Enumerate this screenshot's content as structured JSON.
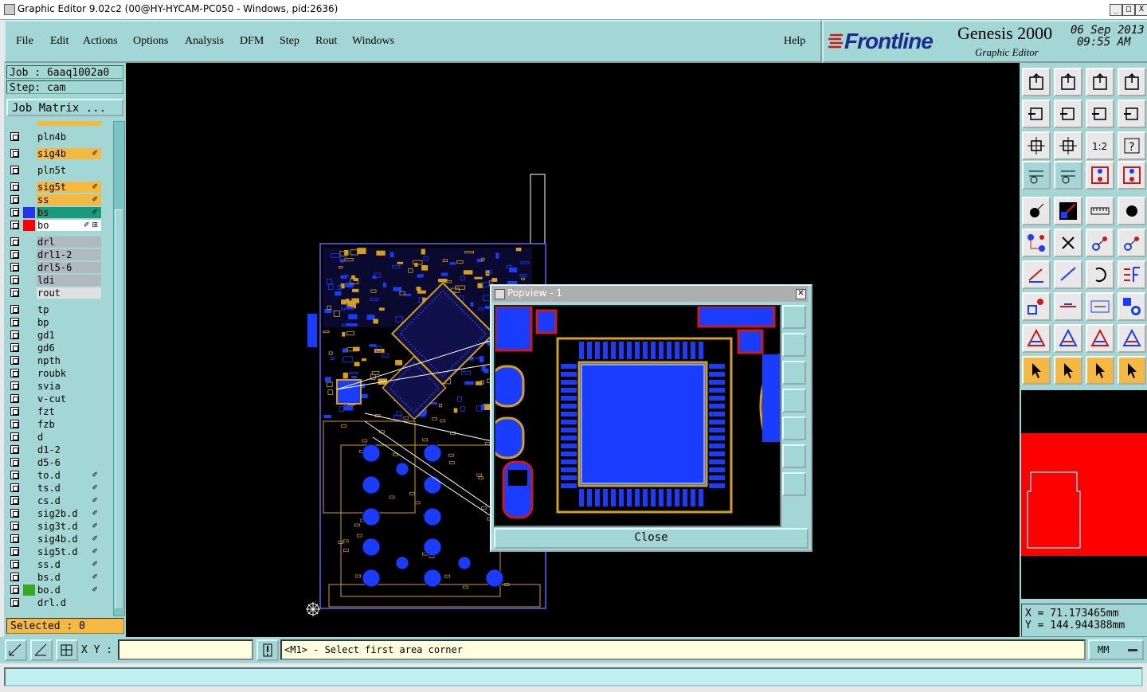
{
  "window": {
    "title": "Graphic Editor 9.02c2 (00@HY-HYCAM-PC050 - Windows, pid:2636)",
    "controls": [
      "_",
      "□",
      "X"
    ]
  },
  "menu": {
    "items": [
      "File",
      "Edit",
      "Actions",
      "Options",
      "Analysis",
      "DFM",
      "Step",
      "Rout",
      "Windows"
    ],
    "help": "Help"
  },
  "brand": {
    "logo": "Frontline",
    "product": "Genesis 2000",
    "subtitle": "Graphic Editor",
    "date": "06 Sep 2013",
    "time": "09:55 AM"
  },
  "job": {
    "job_label": "Job : 6aaq1002a0",
    "step_label": "Step: cam",
    "job_matrix": "Job Matrix ..."
  },
  "layers": [
    {
      "name": "pln4b",
      "color": "#a3d7d6"
    },
    {
      "name": "sig4b",
      "color": "#f5b942",
      "mark": "✐"
    },
    {
      "name": "pln5t",
      "color": "#a3d7d6"
    },
    {
      "name": "sig5t",
      "color": "#f5b942",
      "mark": "✐"
    },
    {
      "name": "ss",
      "color": "#f5b942",
      "mark": "✐"
    },
    {
      "name": "bs",
      "color": "#1a9a7a",
      "swatch": "#2233ee",
      "mark": "✐"
    },
    {
      "name": "bo",
      "color": "#ffffff",
      "swatch": "#ff0000",
      "mark": "✐ ⊞"
    },
    {
      "name": "drl",
      "color": "#b0b8c0"
    },
    {
      "name": "drl1-2",
      "color": "#b0b8c0"
    },
    {
      "name": "drl5-6",
      "color": "#b0b8c0"
    },
    {
      "name": "ldi",
      "color": "#b0b8c0"
    },
    {
      "name": "rout",
      "color": "#e0e0e0"
    },
    {
      "name": "tp",
      "color": "#a3d7d6"
    },
    {
      "name": "bp",
      "color": "#a3d7d6"
    },
    {
      "name": "gd1",
      "color": "#a3d7d6"
    },
    {
      "name": "gd6",
      "color": "#a3d7d6"
    },
    {
      "name": "npth",
      "color": "#a3d7d6"
    },
    {
      "name": "roubk",
      "color": "#a3d7d6"
    },
    {
      "name": "svia",
      "color": "#a3d7d6"
    },
    {
      "name": "v-cut",
      "color": "#a3d7d6"
    },
    {
      "name": "fzt",
      "color": "#a3d7d6"
    },
    {
      "name": "fzb",
      "color": "#a3d7d6"
    },
    {
      "name": "d",
      "color": "#a3d7d6"
    },
    {
      "name": "d1-2",
      "color": "#a3d7d6"
    },
    {
      "name": "d5-6",
      "color": "#a3d7d6"
    },
    {
      "name": "to.d",
      "color": "#a3d7d6",
      "mark": "✐"
    },
    {
      "name": "ts.d",
      "color": "#a3d7d6",
      "mark": "✐"
    },
    {
      "name": "cs.d",
      "color": "#a3d7d6",
      "mark": "✐"
    },
    {
      "name": "sig2b.d",
      "color": "#a3d7d6",
      "mark": "✐"
    },
    {
      "name": "sig3t.d",
      "color": "#a3d7d6",
      "mark": "✐"
    },
    {
      "name": "sig4b.d",
      "color": "#a3d7d6",
      "mark": "✐"
    },
    {
      "name": "sig5t.d",
      "color": "#a3d7d6",
      "mark": "✐"
    },
    {
      "name": "ss.d",
      "color": "#a3d7d6",
      "mark": "✐"
    },
    {
      "name": "bs.d",
      "color": "#a3d7d6",
      "mark": "✐"
    },
    {
      "name": "bo.d",
      "color": "#a3d7d6",
      "swatch": "#33aa22",
      "mark": "✐"
    },
    {
      "name": "drl.d",
      "color": "#a3d7d6"
    }
  ],
  "selected": "Selected : 0",
  "popview": {
    "title": "Popview - 1",
    "close_label": "Close"
  },
  "coords": {
    "x": "X =  71.173465mm",
    "y": "Y =  144.944388mm"
  },
  "command": {
    "xy_label": "X Y :",
    "xy_value": "",
    "message": "<M1> - Select first area corner",
    "unit": "MM"
  },
  "colors": {
    "panel": "#a3d7d6",
    "copper": "#d4a017",
    "pad": "#1a3cff",
    "selected_layer": "#f5b942"
  }
}
